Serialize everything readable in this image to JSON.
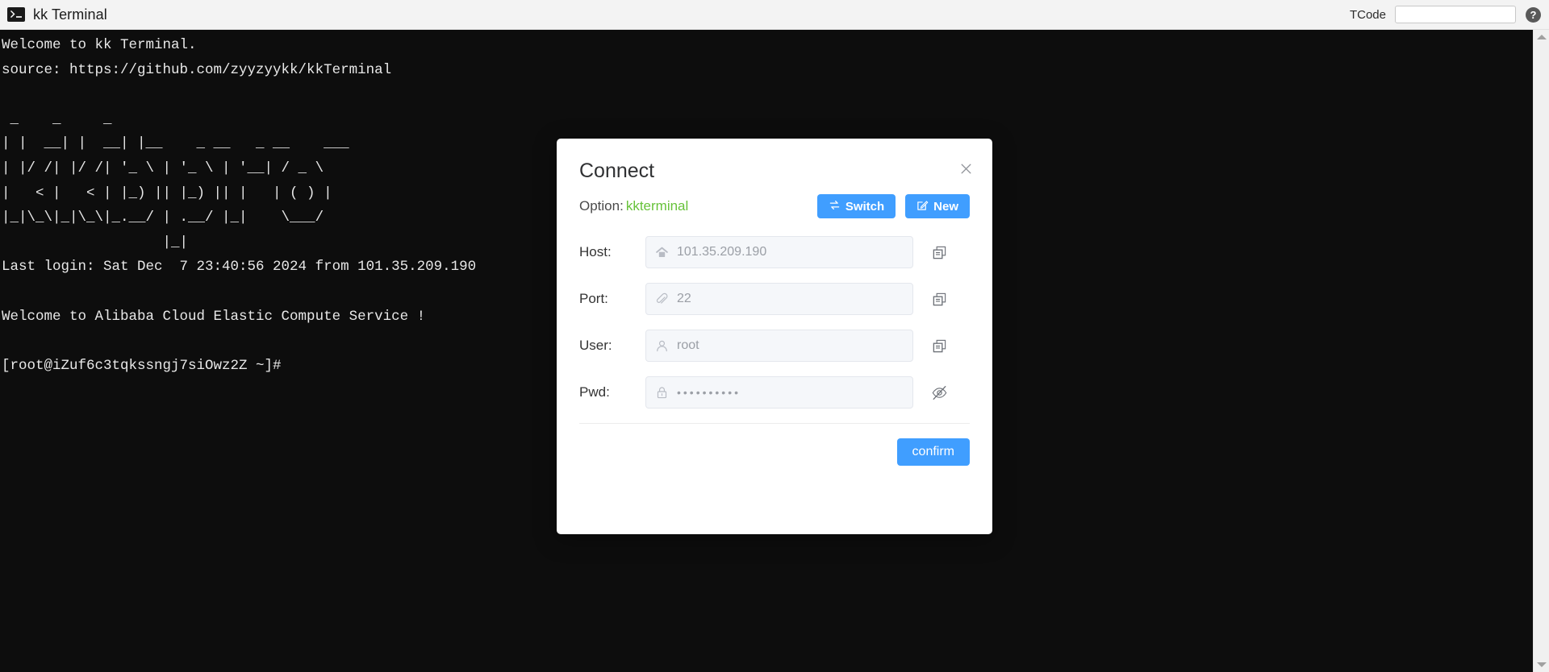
{
  "titlebar": {
    "app_icon": "terminal-icon",
    "title": "kk Terminal",
    "tcode_label": "TCode",
    "tcode_value": "",
    "tcode_placeholder": "",
    "help_glyph": "?"
  },
  "terminal": {
    "background": "#0d0d0d",
    "foreground": "#e8e8e8",
    "lines": "Welcome to kk Terminal.\nsource: https://github.com/zyyzyykk/kkTerminal\n\n _    _     _\n| |  __| |  __| |__    _ __   _ __    ___\n| |/ /| |/ /| '_ \\ | '_ \\ | '__| / _ \\\n|   < |   < | |_) || |_) || |   | ( ) |\n|_|\\_\\|_|\\_\\|_.__/ | .__/ |_|    \\___/\n                   |_|\nLast login: Sat Dec  7 23:40:56 2024 from 101.35.209.190\n\nWelcome to Alibaba Cloud Elastic Compute Service !\n\n[root@iZuf6c3tqkssngj7siOwz2Z ~]#"
  },
  "scrollbar": {
    "up_arrow": "scroll-up-arrow",
    "down_arrow": "scroll-down-arrow"
  },
  "dialog": {
    "title": "Connect",
    "close_glyph": "✕",
    "option": {
      "label": "Option:",
      "value": "kkterminal",
      "value_color": "#67c23a",
      "switch_label": "Switch",
      "switch_icon": "swap-arrows-icon",
      "new_label": "New",
      "new_icon": "edit-square-icon"
    },
    "fields": [
      {
        "label": "Host:",
        "icon": "home-icon",
        "value": "",
        "placeholder": "101.35.209.190",
        "action": "copy-icon"
      },
      {
        "label": "Port:",
        "icon": "paperclip-icon",
        "value": "",
        "placeholder": "22",
        "action": "copy-icon"
      },
      {
        "label": "User:",
        "icon": "person-icon",
        "value": "",
        "placeholder": "root",
        "action": "copy-icon"
      },
      {
        "label": "Pwd:",
        "icon": "lock-icon",
        "masked_value": "••••••••••",
        "action": "eye-off-icon"
      }
    ],
    "confirm_label": "confirm",
    "accent_color": "#409eff"
  }
}
